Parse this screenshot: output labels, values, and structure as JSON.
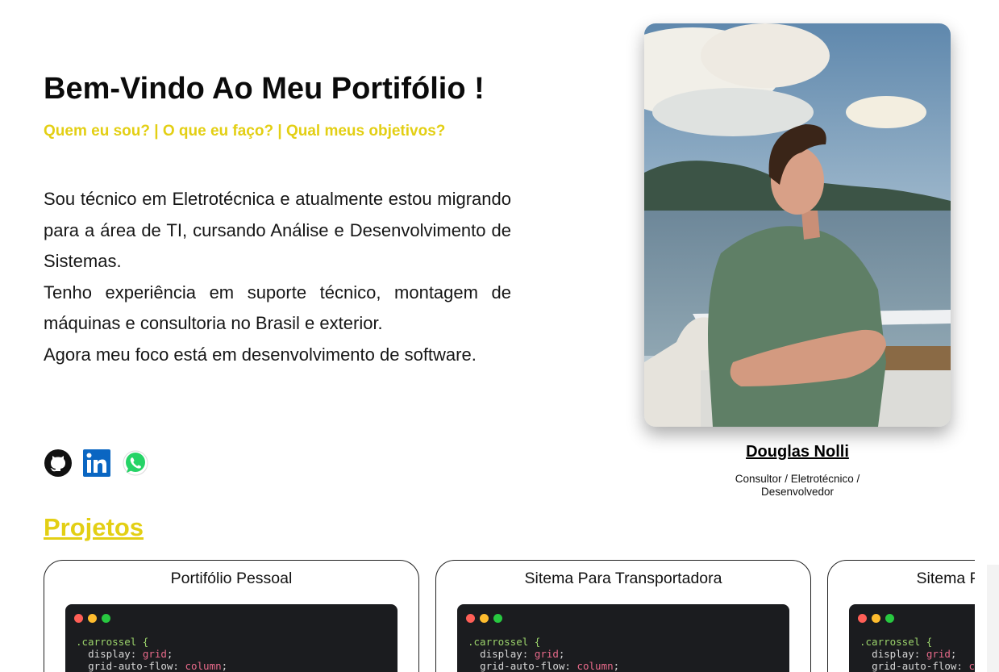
{
  "hero": {
    "title": "Bem-Vindo Ao Meu Portifólio !",
    "subtitle": "Quem eu sou? | O que eu faço? | Qual meus objetivos?",
    "bio": [
      "Sou técnico em Eletrotécnica e atualmente estou migrando para a área de TI, cursando Análise e Desenvolvimento de Sistemas.",
      "Tenho experiência em suporte técnico, montagem de máquinas e consultoria no Brasil e exterior.",
      "Agora meu foco está em desenvolvimento de software."
    ]
  },
  "socials": [
    {
      "icon": "github-icon"
    },
    {
      "icon": "linkedin-icon"
    },
    {
      "icon": "whatsapp-icon"
    }
  ],
  "profile": {
    "name": "Douglas Nolli",
    "role": "Consultor / Eletrotécnico / Desenvolvedor"
  },
  "projects": {
    "section_title": "Projetos",
    "items": [
      {
        "title": "Portifólio Pessoal"
      },
      {
        "title": "Sitema Para Transportadora"
      },
      {
        "title": "Sitema Para Transportadora"
      }
    ],
    "code_preview": {
      "selector": ".carrossel {",
      "line1_prop": "display",
      "line1_val": "grid",
      "line2_prop": "grid-auto-flow",
      "line2_val": "column"
    }
  },
  "colors": {
    "accent": "#e3cf14",
    "linkedin": "#0a66c2",
    "whatsapp": "#25d366",
    "code_bg": "#1b1c1f"
  }
}
